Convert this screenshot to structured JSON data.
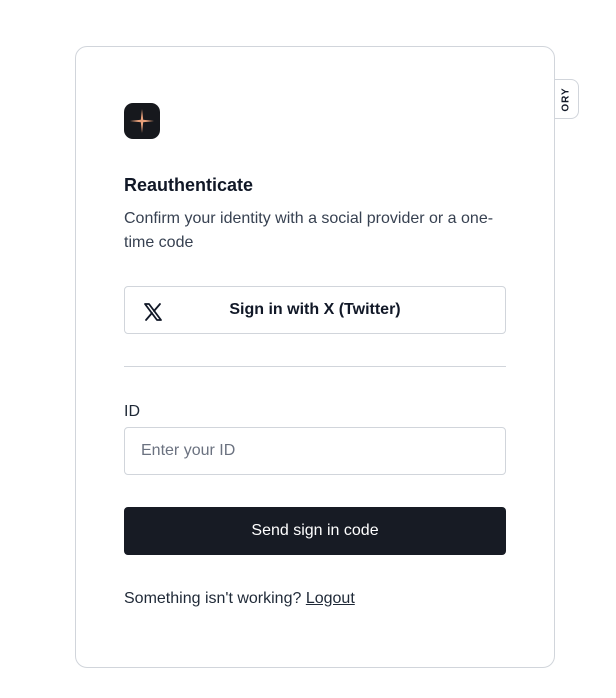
{
  "badge": {
    "text": "ORY"
  },
  "logo": {
    "icon": "sparkle-logo-icon",
    "background": "#16181d",
    "accent": "#e8a07a"
  },
  "form": {
    "title": "Reauthenticate",
    "subtitle": "Confirm your identity with a social provider or a one-time code",
    "social_button_label": "Sign in with X (Twitter)",
    "social_icon": "x-twitter-icon",
    "id_label": "ID",
    "id_placeholder": "Enter your ID",
    "id_value": "",
    "submit_label": "Send sign in code"
  },
  "footer": {
    "prompt": "Something isn't working?",
    "link_label": "Logout"
  },
  "colors": {
    "primary_button": "#171b24",
    "border": "#d1d5db"
  }
}
